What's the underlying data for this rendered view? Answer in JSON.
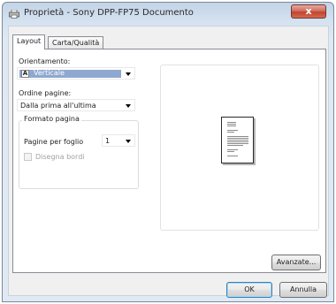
{
  "window": {
    "title": "Proprietà - Sony DPP-FP75 Documento",
    "close_glyph": "x"
  },
  "tabs": [
    {
      "label": "Layout",
      "active": true
    },
    {
      "label": "Carta/Qualità",
      "active": false
    }
  ],
  "layout": {
    "orientation_label": "Orientamento:",
    "orientation_value": "Verticale",
    "orientation_icon_glyph": "A",
    "page_order_label": "Ordine pagine:",
    "page_order_value": "Dalla prima all'ultima",
    "page_format_group": "Formato pagina",
    "pages_per_sheet_label": "Pagine per foglio",
    "pages_per_sheet_value": "1",
    "draw_borders_label": "Disegna bordi",
    "draw_borders_checked": false,
    "draw_borders_enabled": false
  },
  "buttons": {
    "advanced": "Avanzate...",
    "ok": "OK",
    "cancel": "Annulla"
  },
  "icons": {
    "window_icon": "printer-icon",
    "orientation_icon": "portrait-orientation-icon",
    "preview": "page-preview-icon"
  }
}
